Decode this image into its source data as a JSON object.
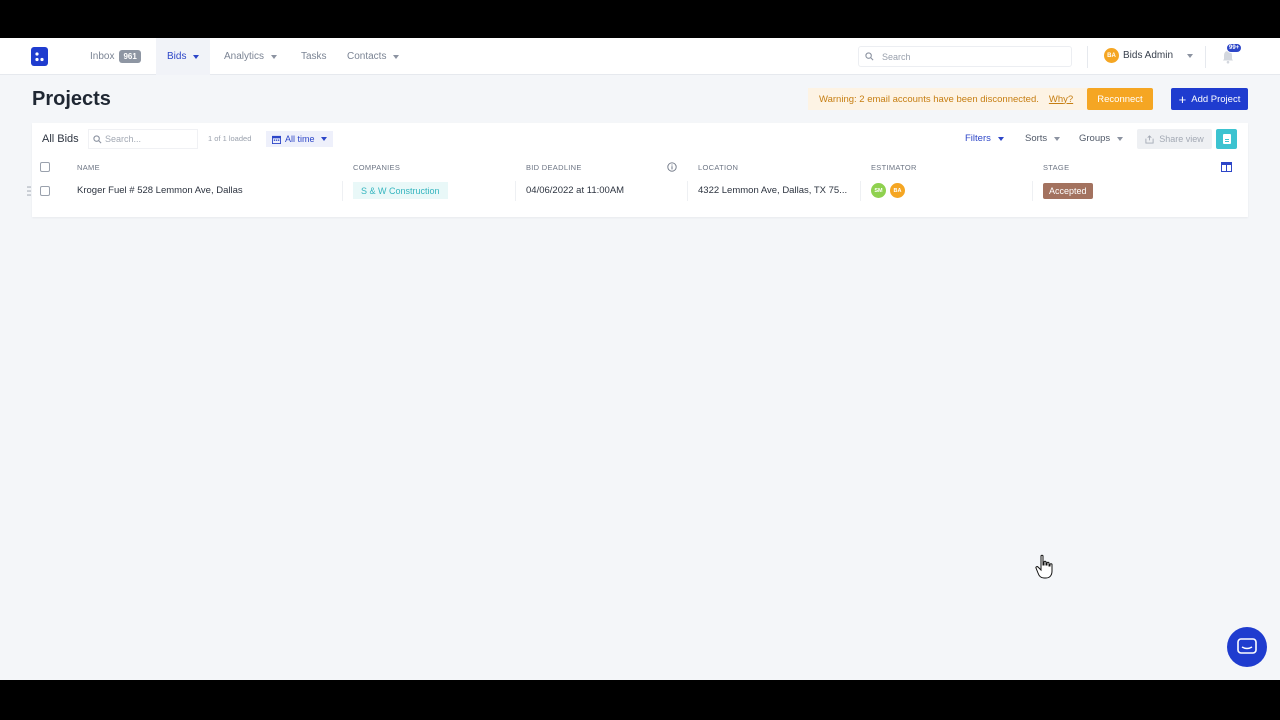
{
  "nav": {
    "inbox_label": "Inbox",
    "inbox_count": "961",
    "bids_label": "Bids",
    "analytics_label": "Analytics",
    "tasks_label": "Tasks",
    "contacts_label": "Contacts",
    "search_placeholder": "Search",
    "user_initials": "BA",
    "user_name": "Bids Admin",
    "notifications_badge": "99+"
  },
  "header": {
    "title": "Projects",
    "warning_text": "Warning: 2 email accounts have been disconnected.",
    "warning_link": "Why?",
    "reconnect_label": "Reconnect",
    "add_project_label": "Add Project"
  },
  "toolbar": {
    "title": "All Bids",
    "search_placeholder": "Search...",
    "loaded_text": "1 of 1 loaded",
    "time_filter": "All time",
    "filters_label": "Filters",
    "sorts_label": "Sorts",
    "groups_label": "Groups",
    "share_label": "Share view"
  },
  "table": {
    "columns": [
      "NAME",
      "COMPANIES",
      "BID DEADLINE",
      "LOCATION",
      "ESTIMATOR",
      "STAGE"
    ],
    "rows": [
      {
        "name": "Kroger Fuel # 528 Lemmon Ave, Dallas",
        "company": "S & W Construction",
        "deadline": "04/06/2022 at 11:00AM",
        "location": "4322 Lemmon Ave, Dallas, TX 75...",
        "estimators": [
          {
            "initials": "SM",
            "color": "#8fd14f"
          },
          {
            "initials": "BA",
            "color": "#f5a623"
          }
        ],
        "stage": "Accepted"
      }
    ]
  },
  "colors": {
    "primary": "#1f3ccf",
    "warning": "#f5a623",
    "teal": "#3cc3d0",
    "stage_accepted": "#a3725f"
  }
}
